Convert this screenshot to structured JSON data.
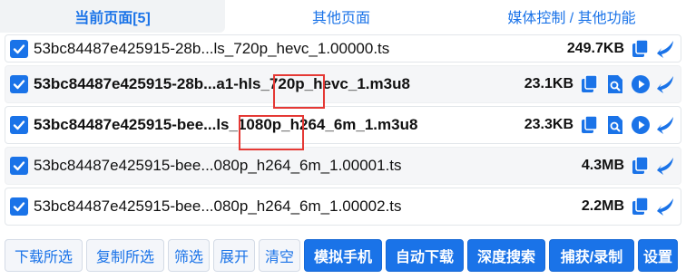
{
  "tabs": [
    {
      "label": "当前页面[5]",
      "active": true
    },
    {
      "label": "其他页面",
      "active": false
    },
    {
      "label": "媒体控制 / 其他功能",
      "active": false
    }
  ],
  "rows": [
    {
      "name": "53bc84487e425915-28b...ls_720p_hevc_1.00000.ts",
      "size": "249.7KB",
      "bold": false,
      "icons": [
        "copy-icon",
        "download-icon"
      ]
    },
    {
      "name": "53bc84487e425915-28b...a1-hls_720p_hevc_1.m3u8",
      "size": "23.1KB",
      "bold": true,
      "icons": [
        "copy-icon",
        "preview-search-icon",
        "play-icon",
        "download-icon"
      ]
    },
    {
      "name": "53bc84487e425915-bee...ls_1080p_h264_6m_1.m3u8",
      "size": "23.3KB",
      "bold": true,
      "icons": [
        "copy-icon",
        "preview-search-icon",
        "play-icon",
        "download-icon"
      ]
    },
    {
      "name": "53bc84487e425915-bee...080p_h264_6m_1.00001.ts",
      "size": "4.3MB",
      "bold": false,
      "icons": [
        "copy-icon",
        "download-icon"
      ]
    },
    {
      "name": "53bc84487e425915-bee...080p_h264_6m_1.00002.ts",
      "size": "2.2MB",
      "bold": false,
      "icons": [
        "copy-icon",
        "download-icon"
      ]
    }
  ],
  "buttons": {
    "download_selected": "下载所选",
    "copy_selected": "复制所选",
    "filter": "筛选",
    "expand": "展开",
    "clear": "清空",
    "mobile_sim": "模拟手机",
    "auto_download": "自动下载",
    "deep_search": "深度搜索",
    "capture_record": "捕获/录制",
    "settings": "设置"
  },
  "colors": {
    "accent": "#1a73e8",
    "highlight": "#e53935"
  }
}
